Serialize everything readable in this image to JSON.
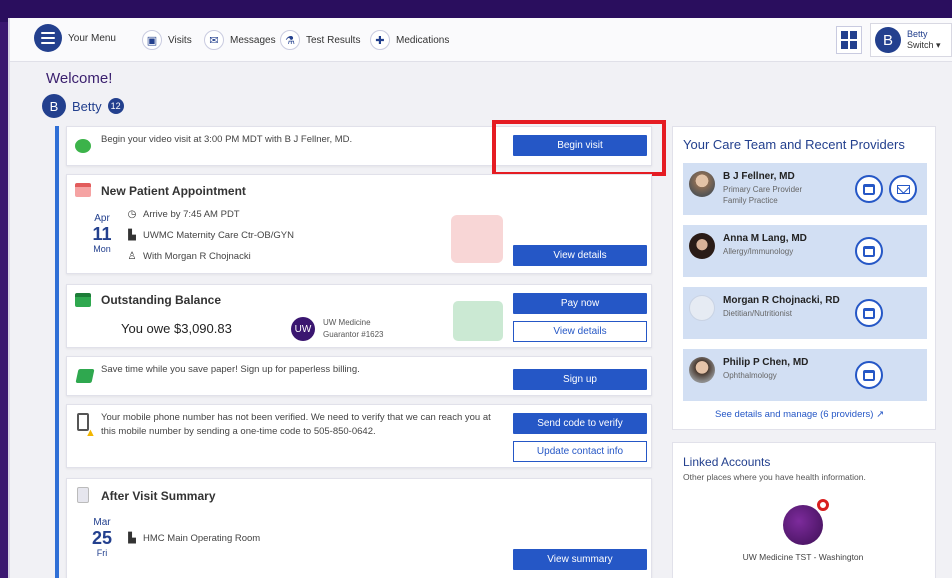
{
  "nav": {
    "menu_label": "Your Menu",
    "items": [
      {
        "label": "Visits",
        "icon": "visits-icon"
      },
      {
        "label": "Messages",
        "icon": "messages-icon"
      },
      {
        "label": "Test Results",
        "icon": "test-results-icon"
      },
      {
        "label": "Medications",
        "icon": "medications-icon"
      }
    ],
    "user": {
      "initial": "B",
      "name": "Betty",
      "switch_label": "Switch"
    }
  },
  "welcome": "Welcome!",
  "patient": {
    "initial": "B",
    "name": "Betty",
    "notification_count": "12"
  },
  "video_visit": {
    "message": "Begin your video visit at 3:00 PM MDT with B J Fellner, MD.",
    "button": "Begin visit"
  },
  "appointment": {
    "title": "New Patient Appointment",
    "month": "Apr",
    "day": "11",
    "weekday": "Mon",
    "arrive": "Arrive by 7:45 AM PDT",
    "location": "UWMC Maternity Care Ctr-OB/GYN",
    "with": "With Morgan R Chojnacki",
    "button": "View details"
  },
  "balance": {
    "title": "Outstanding Balance",
    "amount": "You owe $3,090.83",
    "org_logo": "UW",
    "org_name": "UW Medicine",
    "guarantor": "Guarantor #1623",
    "pay_button": "Pay now",
    "details_button": "View details"
  },
  "paperless": {
    "message": "Save time while you save paper! Sign up for paperless billing.",
    "button": "Sign up"
  },
  "phone_verify": {
    "message": "Your mobile phone number has not been verified. We need to verify that we can reach you at this mobile number by sending a one-time code to 505-850-0642.",
    "send_button": "Send code to verify",
    "update_button": "Update contact info"
  },
  "after_visit": {
    "title": "After Visit Summary",
    "month": "Mar",
    "day": "25",
    "weekday": "Fri",
    "location": "HMC Main Operating Room",
    "button": "View summary"
  },
  "care_team": {
    "title": "Your Care Team and Recent Providers",
    "providers": [
      {
        "name": "B J Fellner, MD",
        "role1": "Primary Care Provider",
        "role2": "Family Practice"
      },
      {
        "name": "Anna M Lang, MD",
        "role1": "Allergy/Immunology",
        "role2": ""
      },
      {
        "name": "Morgan R Chojnacki, RD",
        "role1": "Dietitian/Nutritionist",
        "role2": ""
      },
      {
        "name": "Philip P Chen, MD",
        "role1": "Ophthalmology",
        "role2": ""
      }
    ],
    "see_details": "See details and manage (6 providers) ↗"
  },
  "linked": {
    "title": "Linked Accounts",
    "subtitle": "Other places where you have health information.",
    "account_name": "UW Medicine TST - Washington"
  },
  "colors": {
    "brand": "#23408e",
    "button": "#2557c6",
    "highlight": "#e51c23",
    "provider_bg": "#d2dff3"
  }
}
